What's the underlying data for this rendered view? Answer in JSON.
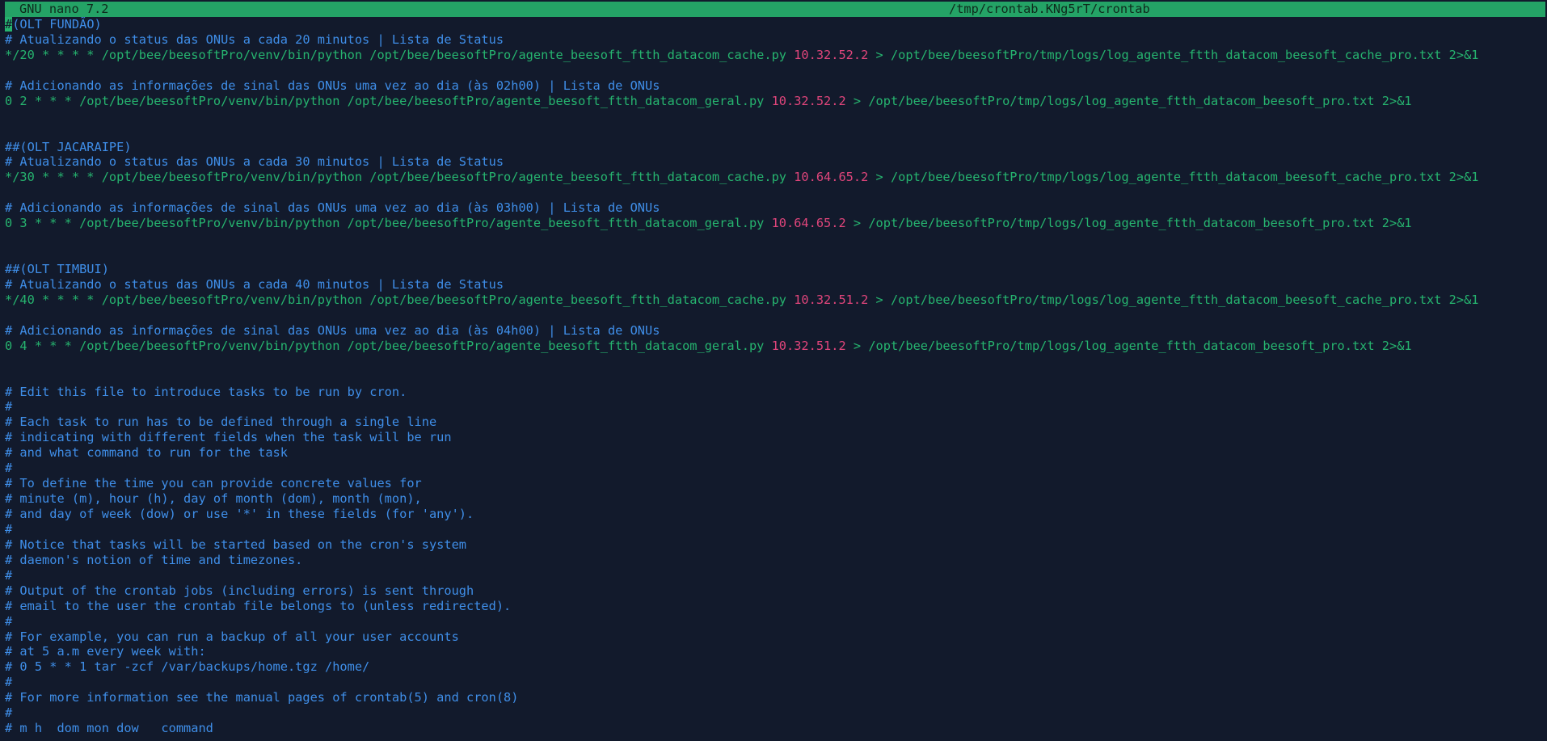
{
  "titlebar": {
    "app": "GNU nano 7.2",
    "filename": "/tmp/crontab.KNg5rT/crontab"
  },
  "colors": {
    "background": "#121a2c",
    "titlebar": "#24a366",
    "comment": "#3f8ee8",
    "command": "#26b46f",
    "ip": "#e0457b"
  },
  "editor": {
    "cursor_char": "#",
    "lines": [
      {
        "type": "cursor",
        "text": "#(OLT FUNDÃO)"
      },
      {
        "type": "comment",
        "text": "# Atualizando o status das ONUs a cada 20 minutos | Lista de Status"
      },
      {
        "type": "command",
        "pre": "*/20 * * * * /opt/bee/beesoftPro/venv/bin/python /opt/bee/beesoftPro/agente_beesoft_ftth_datacom_cache.py ",
        "ip": "10.32.52.2",
        "post": " > /opt/bee/beesoftPro/tmp/logs/log_agente_ftth_datacom_beesoft_cache_pro.txt 2>&1"
      },
      {
        "type": "blank",
        "text": ""
      },
      {
        "type": "comment",
        "text": "# Adicionando as informações de sinal das ONUs uma vez ao dia (às 02h00) | Lista de ONUs"
      },
      {
        "type": "command",
        "pre": "0 2 * * * /opt/bee/beesoftPro/venv/bin/python /opt/bee/beesoftPro/agente_beesoft_ftth_datacom_geral.py ",
        "ip": "10.32.52.2",
        "post": " > /opt/bee/beesoftPro/tmp/logs/log_agente_ftth_datacom_beesoft_pro.txt 2>&1"
      },
      {
        "type": "blank",
        "text": ""
      },
      {
        "type": "blank",
        "text": ""
      },
      {
        "type": "comment",
        "text": "##(OLT JACARAIPE)"
      },
      {
        "type": "comment",
        "text": "# Atualizando o status das ONUs a cada 30 minutos | Lista de Status"
      },
      {
        "type": "command",
        "pre": "*/30 * * * * /opt/bee/beesoftPro/venv/bin/python /opt/bee/beesoftPro/agente_beesoft_ftth_datacom_cache.py ",
        "ip": "10.64.65.2",
        "post": " > /opt/bee/beesoftPro/tmp/logs/log_agente_ftth_datacom_beesoft_cache_pro.txt 2>&1"
      },
      {
        "type": "blank",
        "text": ""
      },
      {
        "type": "comment",
        "text": "# Adicionando as informações de sinal das ONUs uma vez ao dia (às 03h00) | Lista de ONUs"
      },
      {
        "type": "command",
        "pre": "0 3 * * * /opt/bee/beesoftPro/venv/bin/python /opt/bee/beesoftPro/agente_beesoft_ftth_datacom_geral.py ",
        "ip": "10.64.65.2",
        "post": " > /opt/bee/beesoftPro/tmp/logs/log_agente_ftth_datacom_beesoft_pro.txt 2>&1"
      },
      {
        "type": "blank",
        "text": ""
      },
      {
        "type": "blank",
        "text": ""
      },
      {
        "type": "comment",
        "text": "##(OLT TIMBUI)"
      },
      {
        "type": "comment",
        "text": "# Atualizando o status das ONUs a cada 40 minutos | Lista de Status"
      },
      {
        "type": "command",
        "pre": "*/40 * * * * /opt/bee/beesoftPro/venv/bin/python /opt/bee/beesoftPro/agente_beesoft_ftth_datacom_cache.py ",
        "ip": "10.32.51.2",
        "post": " > /opt/bee/beesoftPro/tmp/logs/log_agente_ftth_datacom_beesoft_cache_pro.txt 2>&1"
      },
      {
        "type": "blank",
        "text": ""
      },
      {
        "type": "comment",
        "text": "# Adicionando as informações de sinal das ONUs uma vez ao dia (às 04h00) | Lista de ONUs"
      },
      {
        "type": "command",
        "pre": "0 4 * * * /opt/bee/beesoftPro/venv/bin/python /opt/bee/beesoftPro/agente_beesoft_ftth_datacom_geral.py ",
        "ip": "10.32.51.2",
        "post": " > /opt/bee/beesoftPro/tmp/logs/log_agente_ftth_datacom_beesoft_pro.txt 2>&1"
      },
      {
        "type": "blank",
        "text": ""
      },
      {
        "type": "blank",
        "text": ""
      },
      {
        "type": "comment",
        "text": "# Edit this file to introduce tasks to be run by cron."
      },
      {
        "type": "comment",
        "text": "#"
      },
      {
        "type": "comment",
        "text": "# Each task to run has to be defined through a single line"
      },
      {
        "type": "comment",
        "text": "# indicating with different fields when the task will be run"
      },
      {
        "type": "comment",
        "text": "# and what command to run for the task"
      },
      {
        "type": "comment",
        "text": "#"
      },
      {
        "type": "comment",
        "text": "# To define the time you can provide concrete values for"
      },
      {
        "type": "comment",
        "text": "# minute (m), hour (h), day of month (dom), month (mon),"
      },
      {
        "type": "comment",
        "text": "# and day of week (dow) or use '*' in these fields (for 'any')."
      },
      {
        "type": "comment",
        "text": "#"
      },
      {
        "type": "comment",
        "text": "# Notice that tasks will be started based on the cron's system"
      },
      {
        "type": "comment",
        "text": "# daemon's notion of time and timezones."
      },
      {
        "type": "comment",
        "text": "#"
      },
      {
        "type": "comment",
        "text": "# Output of the crontab jobs (including errors) is sent through"
      },
      {
        "type": "comment",
        "text": "# email to the user the crontab file belongs to (unless redirected)."
      },
      {
        "type": "comment",
        "text": "#"
      },
      {
        "type": "comment",
        "text": "# For example, you can run a backup of all your user accounts"
      },
      {
        "type": "comment",
        "text": "# at 5 a.m every week with:"
      },
      {
        "type": "comment",
        "text": "# 0 5 * * 1 tar -zcf /var/backups/home.tgz /home/"
      },
      {
        "type": "comment",
        "text": "#"
      },
      {
        "type": "comment",
        "text": "# For more information see the manual pages of crontab(5) and cron(8)"
      },
      {
        "type": "comment",
        "text": "#"
      },
      {
        "type": "comment",
        "text": "# m h  dom mon dow   command"
      }
    ]
  }
}
